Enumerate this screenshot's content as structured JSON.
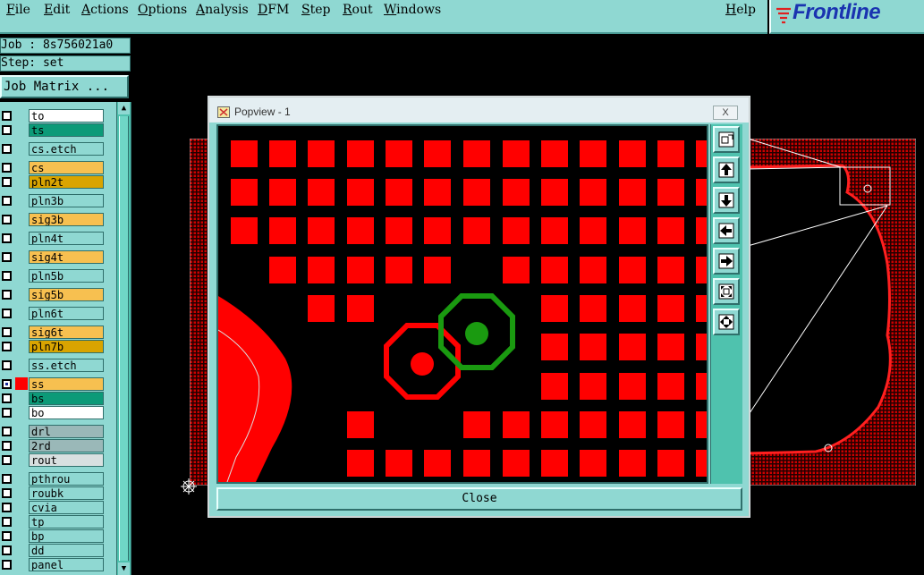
{
  "menu": {
    "file": "File",
    "edit": "Edit",
    "actions": "Actions",
    "options": "Options",
    "analysis": "Analysis",
    "dfm": "DFM",
    "step": "Step",
    "rout": "Rout",
    "windows": "Windows",
    "help": "Help"
  },
  "logo": {
    "text": "Frontline",
    "icon": "frontline-logo-icon",
    "color": "#1a33b0"
  },
  "info": {
    "job": "Job : 8s756021a0",
    "step": "Step: set",
    "job_matrix": "Job Matrix ..."
  },
  "layers": [
    {
      "name": "to",
      "color": "#ffffff"
    },
    {
      "name": "ts",
      "color": "#0c9a78"
    },
    {
      "name": "cs.etch",
      "color": "#8fd8d2"
    },
    {
      "name": "cs",
      "color": "#f7c050"
    },
    {
      "name": "pln2t",
      "color": "#d9a400"
    },
    {
      "name": "pln3b",
      "color": "#8fd8d2"
    },
    {
      "name": "sig3b",
      "color": "#f7c050"
    },
    {
      "name": "pln4t",
      "color": "#8fd8d2"
    },
    {
      "name": "sig4t",
      "color": "#f7c050"
    },
    {
      "name": "pln5b",
      "color": "#8fd8d2"
    },
    {
      "name": "sig5b",
      "color": "#f7c050"
    },
    {
      "name": "pln6t",
      "color": "#8fd8d2"
    },
    {
      "name": "sig6t",
      "color": "#f7c050"
    },
    {
      "name": "pln7b",
      "color": "#d9a400"
    },
    {
      "name": "ss.etch",
      "color": "#8fd8d2"
    },
    {
      "name": "ss",
      "color": "#f7c050",
      "selected": true
    },
    {
      "name": "bs",
      "color": "#0c9a78"
    },
    {
      "name": "bo",
      "color": "#ffffff"
    },
    {
      "name": "drl",
      "color": "#9ab8b8"
    },
    {
      "name": "2rd",
      "color": "#9ab8b8"
    },
    {
      "name": "rout",
      "color": "#d8e0e0"
    },
    {
      "name": "pthrou",
      "color": "#8fd8d2"
    },
    {
      "name": "roubk",
      "color": "#8fd8d2"
    },
    {
      "name": "cvia",
      "color": "#8fd8d2"
    },
    {
      "name": "tp",
      "color": "#8fd8d2"
    },
    {
      "name": "bp",
      "color": "#8fd8d2"
    },
    {
      "name": "dd",
      "color": "#8fd8d2"
    },
    {
      "name": "panel",
      "color": "#8fd8d2"
    }
  ],
  "popview": {
    "title": "Popview - 1",
    "close_x": "X",
    "close_label": "Close",
    "tools": [
      "zoom-window-icon",
      "pan-up-icon",
      "pan-down-icon",
      "pan-left-icon",
      "pan-right-icon",
      "zoom-fit-icon",
      "zoom-in-out-icon"
    ]
  },
  "colors": {
    "panel": "#8fd8d2",
    "copper": "#ff0000",
    "via_green": "#1a9a10",
    "via_red": "#ff0000"
  }
}
